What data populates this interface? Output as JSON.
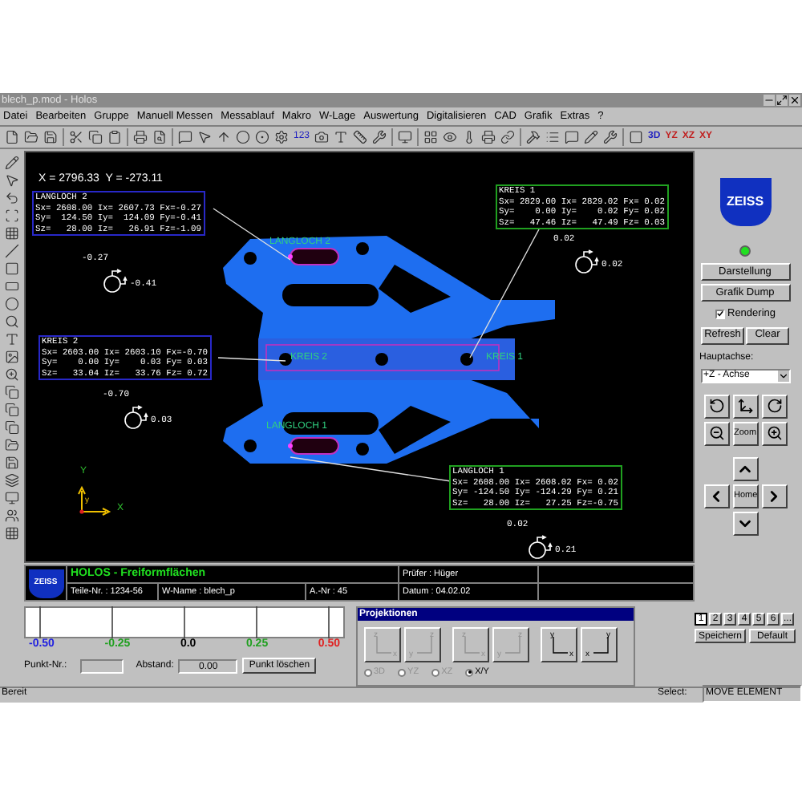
{
  "window": {
    "title": "blech_p.mod - Holos"
  },
  "menu": [
    "Datei",
    "Bearbeiten",
    "Gruppe",
    "Manuell Messen",
    "Messablauf",
    "Makro",
    "W-Lage",
    "Auswertung",
    "Digitalisieren",
    "CAD",
    "Grafik",
    "Extras",
    "?"
  ],
  "toolbar": {
    "counter": "123",
    "views": [
      "3D",
      "YZ",
      "XZ",
      "XY"
    ]
  },
  "canvas": {
    "coordinates": "X = 2796.33  Y = -273.11",
    "annotations": [
      {
        "title": "LANGLOCH 2",
        "color": "#2828c8",
        "lines": [
          "Sx= 2608.00 Ix= 2607.73 Fx=-0.27",
          "Sy=  124.50 Iy=  124.09 Fy=-0.41",
          "Sz=   28.00 Iz=   26.91 Fz=-1.09"
        ],
        "deviations": [
          "-0.27",
          "-0.41"
        ]
      },
      {
        "title": "KREIS 2",
        "color": "#2828c8",
        "lines": [
          "Sx= 2603.00 Ix= 2603.10 Fx=-0.70",
          "Sy=    0.00 Iy=    0.03 Fy= 0.03",
          "Sz=   33.04 Iz=   33.76 Fz= 0.72"
        ],
        "deviations": [
          "-0.70",
          "0.03"
        ]
      },
      {
        "title": "KREIS 1",
        "color": "#20a020",
        "lines": [
          "Sx= 2829.00 Ix= 2829.02 Fx= 0.02",
          "Sy=    0.00 Iy=    0.02 Fy= 0.02",
          "Sz=   47.46 Iz=   47.49 Fz= 0.03"
        ],
        "deviations": [
          "0.02",
          "0.02"
        ]
      },
      {
        "title": "LANGLOCH 1",
        "color": "#20a020",
        "lines": [
          "Sx= 2608.00 Ix= 2608.02 Fx= 0.02",
          "Sy= -124.50 Iy= -124.29 Fy= 0.21",
          "Sz=   28.00 Iz=   27.25 Fz=-0.75"
        ],
        "deviations": [
          "0.02",
          "0.21"
        ]
      }
    ],
    "part_labels": [
      "LANGLOCH 2",
      "KREIS 2",
      "KREIS 1",
      "LANGLOCH 1"
    ],
    "axes": {
      "y": "Y",
      "x": "X",
      "small_y": "y"
    }
  },
  "info": {
    "logo": "ZEISS",
    "title": "HOLOS - Freiformflächen",
    "part_no": "Teile-Nr. : 1234-56",
    "w_name": "W-Name : blech_p",
    "a_no": "A.-Nr : 45",
    "inspector": "Prüfer : Hüger",
    "date": "Datum : 04.02.02"
  },
  "side_panel": {
    "logo": "ZEISS",
    "status_on": true,
    "buttons": [
      "Darstellung",
      "Grafik Dump"
    ],
    "rendering": {
      "label": "Rendering",
      "checked": true
    },
    "refresh": "Refresh",
    "clear": "Clear",
    "axis_label": "Hauptachse:",
    "axis_value": "+Z - Achse",
    "zoom": "Zoom",
    "home": "Home"
  },
  "deviation_scale": {
    "labels": [
      {
        "text": "-0.50",
        "color": "#2020e0"
      },
      {
        "text": "-0.25",
        "color": "#20a020"
      },
      {
        "text": "0.0",
        "color": "#000000"
      },
      {
        "text": "0.25",
        "color": "#20a020"
      },
      {
        "text": "0.50",
        "color": "#e02020"
      }
    ],
    "point_label": "Punkt-Nr.:",
    "distance_label": "Abstand:",
    "distance_value": "0.00",
    "delete_button": "Punkt löschen"
  },
  "projections": {
    "title": "Projektionen",
    "buttons": [
      {
        "vertical": "z",
        "horizontal": "x",
        "mirrored": false,
        "disabled": true
      },
      {
        "vertical": "z",
        "horizontal": "y",
        "mirrored": true,
        "disabled": true
      },
      {
        "vertical": "z",
        "horizontal": "x",
        "mirrored": false,
        "disabled": true
      },
      {
        "vertical": "z",
        "horizontal": "y",
        "mirrored": true,
        "disabled": true
      },
      {
        "vertical": "y",
        "horizontal": "x",
        "mirrored": false,
        "disabled": false
      },
      {
        "vertical": "y",
        "horizontal": "x",
        "mirrored": true,
        "disabled": false
      }
    ],
    "radios": [
      {
        "label": "3D",
        "selected": false,
        "disabled": true
      },
      {
        "label": "YZ",
        "selected": false,
        "disabled": true
      },
      {
        "label": "XZ",
        "selected": false,
        "disabled": true
      },
      {
        "label": "X/Y",
        "selected": true,
        "disabled": false
      }
    ]
  },
  "slots": [
    {
      "label": "1",
      "selected": true
    },
    {
      "label": "2",
      "selected": false
    },
    {
      "label": "3",
      "selected": false
    },
    {
      "label": "4",
      "selected": false
    },
    {
      "label": "5",
      "selected": false
    },
    {
      "label": "6",
      "selected": false
    },
    {
      "label": "...",
      "selected": false
    }
  ],
  "save_button": "Speichern",
  "default_button": "Default",
  "status_bar": [
    "Bereit",
    "Select:",
    "MOVE ELEMENT"
  ]
}
